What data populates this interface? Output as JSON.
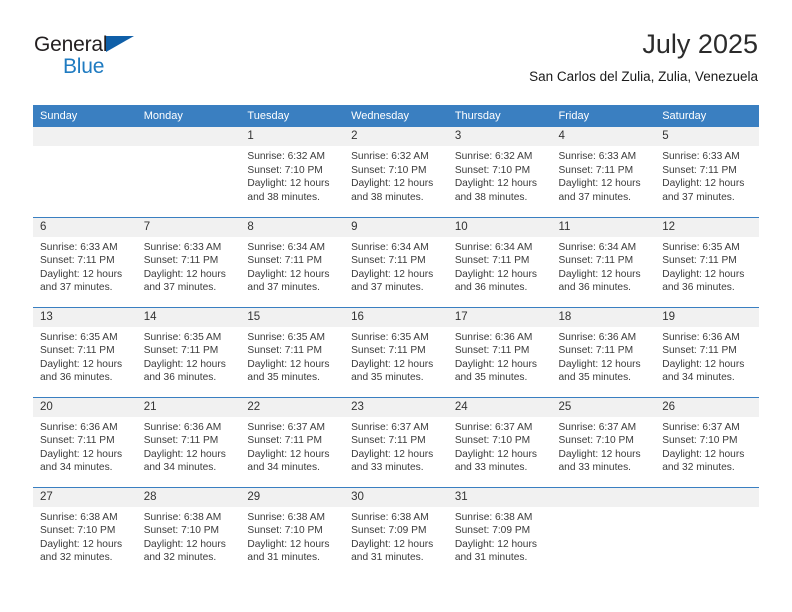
{
  "brand": {
    "name_part1": "General",
    "name_part2": "Blue",
    "triangle_color": "#0f5fa8",
    "blue_color": "#1f7bc1"
  },
  "header": {
    "title": "July 2025",
    "subtitle": "San Carlos del Zulia, Zulia, Venezuela"
  },
  "theme": {
    "header_blue": "#3a7fc1",
    "daynum_gray": "#f1f1f1",
    "text_color": "#3b3b3b"
  },
  "weekday_headers": [
    "Sunday",
    "Monday",
    "Tuesday",
    "Wednesday",
    "Thursday",
    "Friday",
    "Saturday"
  ],
  "weeks": [
    [
      {
        "day": "",
        "sunrise": "",
        "sunset": "",
        "daylight": "",
        "empty": true
      },
      {
        "day": "",
        "sunrise": "",
        "sunset": "",
        "daylight": "",
        "empty": true
      },
      {
        "day": "1",
        "sunrise": "Sunrise: 6:32 AM",
        "sunset": "Sunset: 7:10 PM",
        "daylight": "Daylight: 12 hours and 38 minutes."
      },
      {
        "day": "2",
        "sunrise": "Sunrise: 6:32 AM",
        "sunset": "Sunset: 7:10 PM",
        "daylight": "Daylight: 12 hours and 38 minutes."
      },
      {
        "day": "3",
        "sunrise": "Sunrise: 6:32 AM",
        "sunset": "Sunset: 7:10 PM",
        "daylight": "Daylight: 12 hours and 38 minutes."
      },
      {
        "day": "4",
        "sunrise": "Sunrise: 6:33 AM",
        "sunset": "Sunset: 7:11 PM",
        "daylight": "Daylight: 12 hours and 37 minutes."
      },
      {
        "day": "5",
        "sunrise": "Sunrise: 6:33 AM",
        "sunset": "Sunset: 7:11 PM",
        "daylight": "Daylight: 12 hours and 37 minutes."
      }
    ],
    [
      {
        "day": "6",
        "sunrise": "Sunrise: 6:33 AM",
        "sunset": "Sunset: 7:11 PM",
        "daylight": "Daylight: 12 hours and 37 minutes."
      },
      {
        "day": "7",
        "sunrise": "Sunrise: 6:33 AM",
        "sunset": "Sunset: 7:11 PM",
        "daylight": "Daylight: 12 hours and 37 minutes."
      },
      {
        "day": "8",
        "sunrise": "Sunrise: 6:34 AM",
        "sunset": "Sunset: 7:11 PM",
        "daylight": "Daylight: 12 hours and 37 minutes."
      },
      {
        "day": "9",
        "sunrise": "Sunrise: 6:34 AM",
        "sunset": "Sunset: 7:11 PM",
        "daylight": "Daylight: 12 hours and 37 minutes."
      },
      {
        "day": "10",
        "sunrise": "Sunrise: 6:34 AM",
        "sunset": "Sunset: 7:11 PM",
        "daylight": "Daylight: 12 hours and 36 minutes."
      },
      {
        "day": "11",
        "sunrise": "Sunrise: 6:34 AM",
        "sunset": "Sunset: 7:11 PM",
        "daylight": "Daylight: 12 hours and 36 minutes."
      },
      {
        "day": "12",
        "sunrise": "Sunrise: 6:35 AM",
        "sunset": "Sunset: 7:11 PM",
        "daylight": "Daylight: 12 hours and 36 minutes."
      }
    ],
    [
      {
        "day": "13",
        "sunrise": "Sunrise: 6:35 AM",
        "sunset": "Sunset: 7:11 PM",
        "daylight": "Daylight: 12 hours and 36 minutes."
      },
      {
        "day": "14",
        "sunrise": "Sunrise: 6:35 AM",
        "sunset": "Sunset: 7:11 PM",
        "daylight": "Daylight: 12 hours and 36 minutes."
      },
      {
        "day": "15",
        "sunrise": "Sunrise: 6:35 AM",
        "sunset": "Sunset: 7:11 PM",
        "daylight": "Daylight: 12 hours and 35 minutes."
      },
      {
        "day": "16",
        "sunrise": "Sunrise: 6:35 AM",
        "sunset": "Sunset: 7:11 PM",
        "daylight": "Daylight: 12 hours and 35 minutes."
      },
      {
        "day": "17",
        "sunrise": "Sunrise: 6:36 AM",
        "sunset": "Sunset: 7:11 PM",
        "daylight": "Daylight: 12 hours and 35 minutes."
      },
      {
        "day": "18",
        "sunrise": "Sunrise: 6:36 AM",
        "sunset": "Sunset: 7:11 PM",
        "daylight": "Daylight: 12 hours and 35 minutes."
      },
      {
        "day": "19",
        "sunrise": "Sunrise: 6:36 AM",
        "sunset": "Sunset: 7:11 PM",
        "daylight": "Daylight: 12 hours and 34 minutes."
      }
    ],
    [
      {
        "day": "20",
        "sunrise": "Sunrise: 6:36 AM",
        "sunset": "Sunset: 7:11 PM",
        "daylight": "Daylight: 12 hours and 34 minutes."
      },
      {
        "day": "21",
        "sunrise": "Sunrise: 6:36 AM",
        "sunset": "Sunset: 7:11 PM",
        "daylight": "Daylight: 12 hours and 34 minutes."
      },
      {
        "day": "22",
        "sunrise": "Sunrise: 6:37 AM",
        "sunset": "Sunset: 7:11 PM",
        "daylight": "Daylight: 12 hours and 34 minutes."
      },
      {
        "day": "23",
        "sunrise": "Sunrise: 6:37 AM",
        "sunset": "Sunset: 7:11 PM",
        "daylight": "Daylight: 12 hours and 33 minutes."
      },
      {
        "day": "24",
        "sunrise": "Sunrise: 6:37 AM",
        "sunset": "Sunset: 7:10 PM",
        "daylight": "Daylight: 12 hours and 33 minutes."
      },
      {
        "day": "25",
        "sunrise": "Sunrise: 6:37 AM",
        "sunset": "Sunset: 7:10 PM",
        "daylight": "Daylight: 12 hours and 33 minutes."
      },
      {
        "day": "26",
        "sunrise": "Sunrise: 6:37 AM",
        "sunset": "Sunset: 7:10 PM",
        "daylight": "Daylight: 12 hours and 32 minutes."
      }
    ],
    [
      {
        "day": "27",
        "sunrise": "Sunrise: 6:38 AM",
        "sunset": "Sunset: 7:10 PM",
        "daylight": "Daylight: 12 hours and 32 minutes."
      },
      {
        "day": "28",
        "sunrise": "Sunrise: 6:38 AM",
        "sunset": "Sunset: 7:10 PM",
        "daylight": "Daylight: 12 hours and 32 minutes."
      },
      {
        "day": "29",
        "sunrise": "Sunrise: 6:38 AM",
        "sunset": "Sunset: 7:10 PM",
        "daylight": "Daylight: 12 hours and 31 minutes."
      },
      {
        "day": "30",
        "sunrise": "Sunrise: 6:38 AM",
        "sunset": "Sunset: 7:09 PM",
        "daylight": "Daylight: 12 hours and 31 minutes."
      },
      {
        "day": "31",
        "sunrise": "Sunrise: 6:38 AM",
        "sunset": "Sunset: 7:09 PM",
        "daylight": "Daylight: 12 hours and 31 minutes."
      },
      {
        "day": "",
        "sunrise": "",
        "sunset": "",
        "daylight": "",
        "empty": true
      },
      {
        "day": "",
        "sunrise": "",
        "sunset": "",
        "daylight": "",
        "empty": true
      }
    ]
  ]
}
